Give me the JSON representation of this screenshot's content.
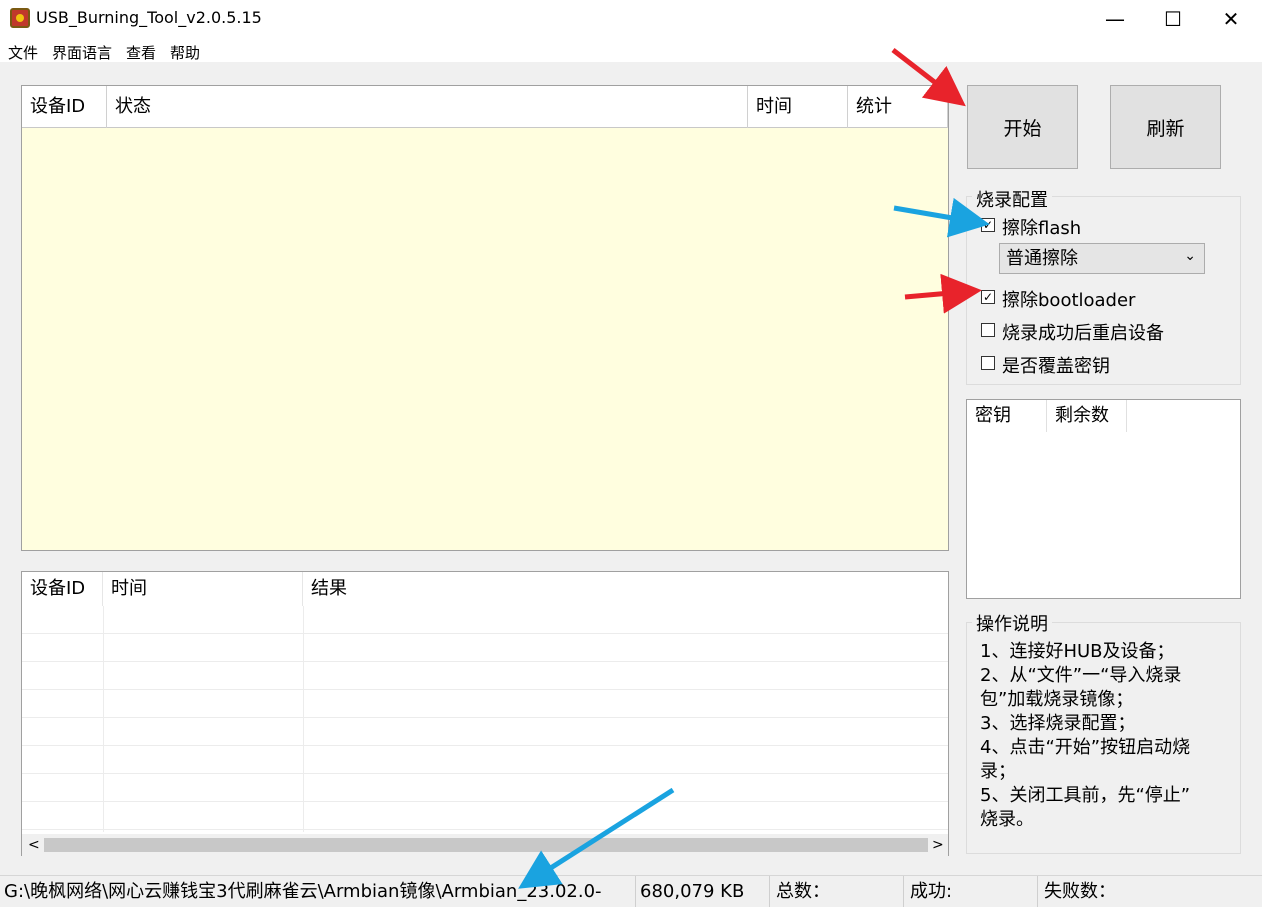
{
  "window": {
    "title": "USB_Burning_Tool_v2.0.5.15",
    "minimize_glyph": "—",
    "maximize_glyph": "☐",
    "close_glyph": "✕"
  },
  "menu": [
    "文件",
    "界面语言",
    "查看",
    "帮助"
  ],
  "device_table": {
    "columns": [
      "设备ID",
      "状态",
      "时间",
      "统计"
    ]
  },
  "log_table": {
    "columns": [
      "设备ID",
      "时间",
      "结果"
    ],
    "scroll_left": "<",
    "scroll_right": ">"
  },
  "buttons": {
    "start": "开始",
    "refresh": "刷新"
  },
  "burn_config": {
    "title": "烧录配置",
    "erase_flash": {
      "label": "擦除flash",
      "checked": true
    },
    "erase_mode": "普通擦除",
    "erase_bootloader": {
      "label": "擦除bootloader",
      "checked": true
    },
    "reboot_after": {
      "label": "烧录成功后重启设备",
      "checked": false
    },
    "overwrite_key": {
      "label": "是否覆盖密钥",
      "checked": false
    },
    "check_glyph": "✓",
    "dropdown_glyph": "⌄"
  },
  "key_table": {
    "columns": [
      "密钥",
      "剩余数"
    ]
  },
  "instructions": {
    "title": "操作说明",
    "lines": [
      "1、连接好HUB及设备；",
      "2、从“文件”一“导入烧录",
      "包”加载烧录镜像；",
      "3、选择烧录配置；",
      "4、点击“开始”按钮启动烧",
      "录；",
      "5、关闭工具前，先“停止”",
      "烧录。"
    ]
  },
  "status": {
    "path": "G:\\晚枫网络\\网心云赚钱宝3代刷麻雀云\\Armbian镜像\\Armbian_23.02.0-",
    "size": "680,079 KB",
    "total": "总数：",
    "success": "成功:",
    "failed": "失败数："
  },
  "colors": {
    "device_list_bg": "#fffedf",
    "arrow_red": "#e8232b",
    "arrow_blue": "#1aa3e0"
  }
}
